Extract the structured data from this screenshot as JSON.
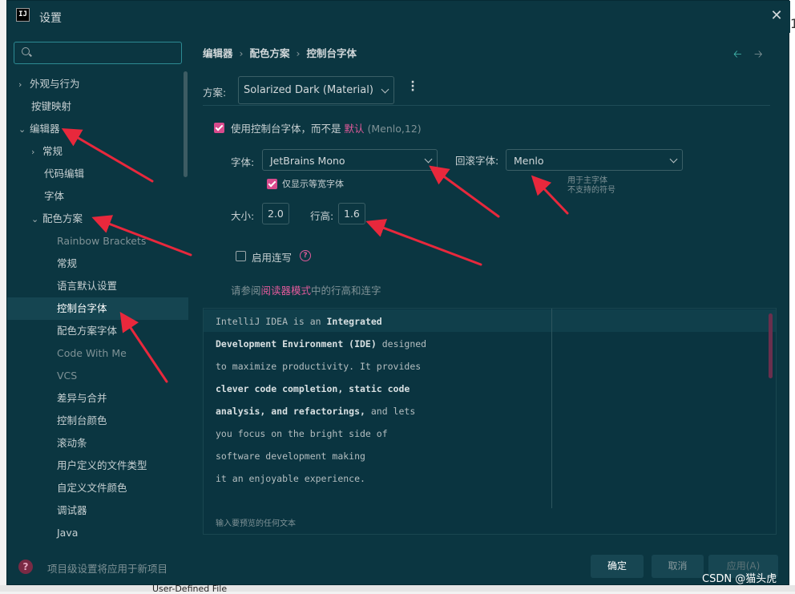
{
  "window": {
    "title": "设置",
    "close": "✕",
    "app_icon_text": "IJ"
  },
  "sidebar": {
    "search_placeholder": "",
    "items": [
      {
        "label": "外观与行为",
        "expand": "›"
      },
      {
        "label": "按键映射"
      },
      {
        "label": "编辑器",
        "expand": "⌄"
      },
      {
        "label": "常规",
        "expand": "›"
      },
      {
        "label": "代码编辑"
      },
      {
        "label": "字体"
      },
      {
        "label": "配色方案",
        "expand": "⌄"
      },
      {
        "label": "Rainbow Brackets"
      },
      {
        "label": "常规"
      },
      {
        "label": "语言默认设置"
      },
      {
        "label": "控制台字体"
      },
      {
        "label": "配色方案字体"
      },
      {
        "label": "Code With Me"
      },
      {
        "label": "VCS"
      },
      {
        "label": "差异与合并"
      },
      {
        "label": "控制台颜色"
      },
      {
        "label": "滚动条"
      },
      {
        "label": "用户定义的文件类型"
      },
      {
        "label": "自定义文件颜色"
      },
      {
        "label": "调试器"
      },
      {
        "label": "Java"
      }
    ]
  },
  "breadcrumb": {
    "part1": "编辑器",
    "part2": "配色方案",
    "part3": "控制台字体",
    "sep": "›"
  },
  "nav": {
    "back": "🡠",
    "forward": "🡢"
  },
  "scheme": {
    "label": "方案:",
    "value": "Solarized Dark (Material)"
  },
  "console_font": {
    "use_label": "使用控制台字体，而不是",
    "default_link": "默认",
    "default_value": "(Menlo,12)",
    "font_label": "字体:",
    "font_value": "JetBrains Mono",
    "mono_only_label": "仅显示等宽字体",
    "fallback_label": "回滚字体:",
    "fallback_value": "Menlo",
    "fallback_hint_1": "用于主字体",
    "fallback_hint_2": "不支持的符号",
    "size_label": "大小:",
    "size_value": "2.0",
    "line_height_label": "行高:",
    "line_height_value": "1.6",
    "ligatures_label": "启用连写",
    "reader_prefix": "请参阅",
    "reader_link": "阅读器模式",
    "reader_suffix": "中的行高和连字"
  },
  "preview": {
    "l1a": "IntelliJ IDEA is an ",
    "l1b": "Integrated",
    "l2a": "Development Environment (IDE)",
    "l2b": " designed",
    "l3": "to maximize productivity. It provides",
    "l4": "clever code completion, static code",
    "l5a": "analysis, and refactorings,",
    "l5b": " and lets",
    "l6": "you focus on the bright side of",
    "l7": "software development making",
    "l8": "it an enjoyable experience.",
    "footer": "输入要预览的任何文本"
  },
  "footer": {
    "help": "?",
    "note": "项目级设置将应用于新项目",
    "ok": "确定",
    "cancel": "取消",
    "apply": "应用(A)"
  },
  "watermark": "CSDN @猫头虎",
  "background": {
    "peek_top": "1",
    "bottom_text": "User-Defined File"
  },
  "colors": {
    "bg": "#0b3641",
    "accent": "#d84a8c",
    "link": "#e05a9a",
    "selection": "#154551",
    "arrow": "#e8283c"
  }
}
